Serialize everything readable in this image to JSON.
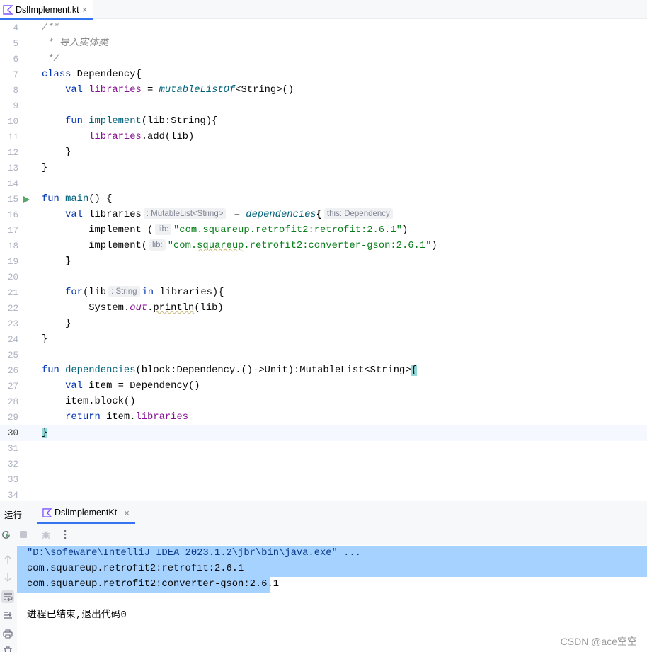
{
  "editor_tab": {
    "label": "DslImplement.kt",
    "icon": "kotlin-file-icon",
    "close": "×"
  },
  "code_lines": [
    {
      "num": "4"
    },
    {
      "num": "5"
    },
    {
      "num": "6"
    },
    {
      "num": "7"
    },
    {
      "num": "8"
    },
    {
      "num": "9"
    },
    {
      "num": "10"
    },
    {
      "num": "11"
    },
    {
      "num": "12"
    },
    {
      "num": "13"
    },
    {
      "num": "14"
    },
    {
      "num": "15"
    },
    {
      "num": "16"
    },
    {
      "num": "17"
    },
    {
      "num": "18"
    },
    {
      "num": "19"
    },
    {
      "num": "20"
    },
    {
      "num": "21"
    },
    {
      "num": "22"
    },
    {
      "num": "23"
    },
    {
      "num": "24"
    },
    {
      "num": "25"
    },
    {
      "num": "26"
    },
    {
      "num": "27"
    },
    {
      "num": "28"
    },
    {
      "num": "29"
    },
    {
      "num": "30"
    },
    {
      "num": "31"
    },
    {
      "num": "32"
    },
    {
      "num": "33"
    },
    {
      "num": "34"
    }
  ],
  "code": {
    "l4": "/**",
    "l5": " * 导入实体类",
    "l6": " */",
    "l7_kw": "class",
    "l7_rest": " Dependency{",
    "l8_kw": "val",
    "l8_prop": "libraries",
    "l8_eq": " = ",
    "l8_fn": "mutableListOf",
    "l8_rest": "<String>()",
    "l10_kw": "fun",
    "l10_fn": "implement",
    "l10_rest": "(lib:String){",
    "l11_prop": "libraries",
    "l11_rest": ".add(lib)",
    "l12": "}",
    "l13": "}",
    "l15_kw": "fun",
    "l15_fn": "main",
    "l15_rest": "() {",
    "l16_kw": "val",
    "l16_name": " libraries",
    "l16_hint": ": MutableList<String>",
    "l16_eq": "= ",
    "l16_fn": "dependencies",
    "l16_brace": "{",
    "l16_hint2": "this: Dependency",
    "l17_call": "implement (",
    "l17_hint": "lib:",
    "l17_str": "\"com.squareup.retrofit2:retrofit:2.6.1\"",
    "l17_end": ")",
    "l18_call": "implement(",
    "l18_hint": "lib:",
    "l18_str_a": "\"com.",
    "l18_str_b": "squareup",
    "l18_str_c": ".retrofit2:converter-gson:2.6.1\"",
    "l18_end": ")",
    "l19": "}",
    "l21_kw": "for",
    "l21_a": "(lib",
    "l21_hint": ": String",
    "l21_kw2": "in",
    "l21_rest": " libraries){",
    "l22_a": "System.",
    "l22_prop": "out",
    "l22_b": ".",
    "l22_c": "println",
    "l22_d": "(lib)",
    "l23": "}",
    "l24": "}",
    "l26_kw": "fun",
    "l26_fn": "dependencies",
    "l26_rest": "(block:Dependency.()->Unit):MutableList<String>",
    "l26_brace": "{",
    "l27_kw": "val",
    "l27_rest": " item = Dependency()",
    "l28": "item.block()",
    "l29_kw": "return",
    "l29_a": " item.",
    "l29_prop": "libraries",
    "l30": "}"
  },
  "run_panel": {
    "title": "运行",
    "tab_label": "DslImplementKt",
    "tab_close": "×",
    "toolbar_icons": [
      "rerun-icon",
      "stop-icon",
      "debug-icon",
      "more-icon"
    ],
    "side_icons": [
      "scroll-up-icon",
      "scroll-down-icon",
      "soft-wrap-icon",
      "scroll-to-end-icon",
      "print-icon",
      "clear-icon"
    ]
  },
  "console": {
    "line1": "\"D:\\sofeware\\IntelliJ IDEA 2023.1.2\\jbr\\bin\\java.exe\" ...",
    "line2": "com.squareup.retrofit2:retrofit:2.6.1",
    "line3": "com.squareup.retrofit2:converter-gson:2.6.1",
    "line5": "进程已结束,退出代码0"
  },
  "watermark": "CSDN @ace空空",
  "colors": {
    "keyword": "#0033b3",
    "property": "#871094",
    "function": "#00627a",
    "string": "#067d17",
    "comment": "#8c8c8c",
    "selection": "#a6d2ff",
    "run_gutter": "#55a76a",
    "accent": "#3574f0"
  }
}
